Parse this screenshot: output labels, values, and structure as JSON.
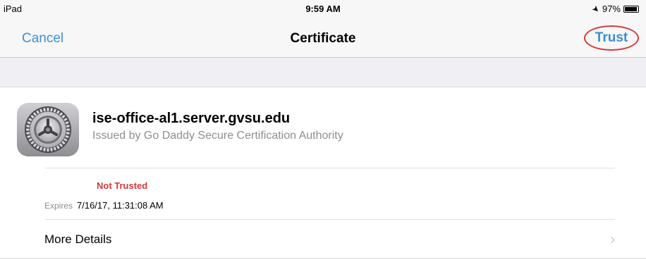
{
  "status_bar": {
    "device": "iPad",
    "time": "9:59 AM",
    "location_icon": "location-arrow-icon",
    "battery_text": "97%",
    "battery_level": 0.97
  },
  "nav": {
    "cancel_label": "Cancel",
    "title": "Certificate",
    "trust_label": "Trust",
    "annotation_color": "#d6393a",
    "tint_color": "#3d8fd1"
  },
  "certificate": {
    "icon": "settings-gear-icon",
    "name": "ise-office-al1.server.gvsu.edu",
    "issuer": "Issued by Go Daddy Secure Certification Authority",
    "trust_status": "Not Trusted",
    "trust_status_color": "#d9363b",
    "expires_label": "Expires",
    "expires_value": "7/16/17, 11:31:08 AM"
  },
  "more_details": {
    "label": "More Details",
    "chevron": "chevron-right-icon"
  }
}
